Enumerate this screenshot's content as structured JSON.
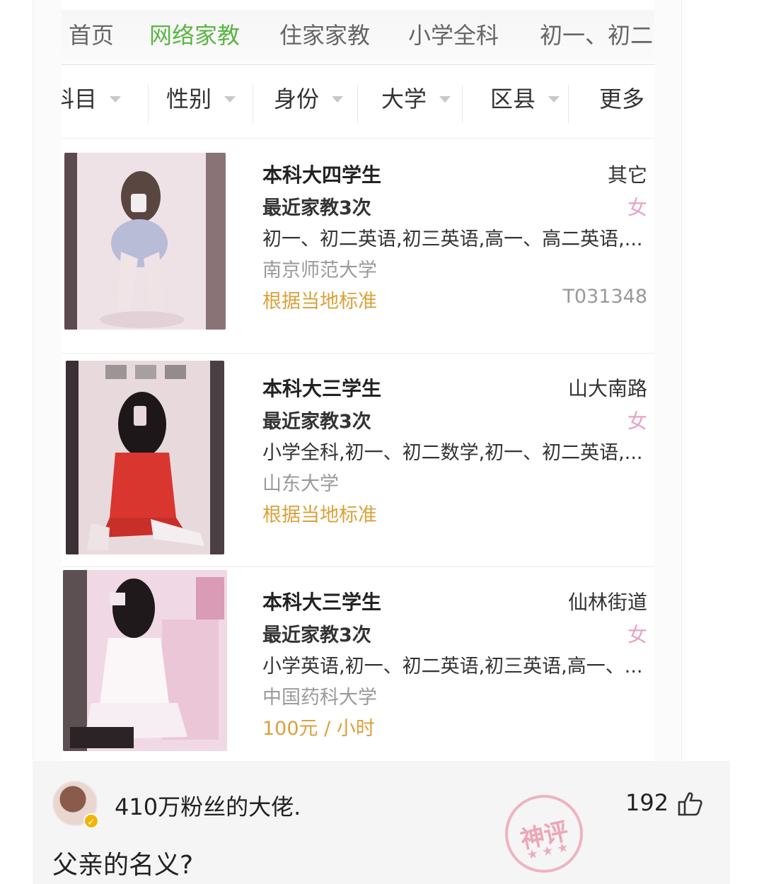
{
  "tabs": [
    "首页",
    "网络家教",
    "住家家教",
    "小学全科",
    "初一、初二"
  ],
  "active_tab": "网络家教",
  "filters": [
    "科目",
    "性别",
    "身份",
    "大学",
    "区县",
    "更多"
  ],
  "listings": [
    {
      "degree": "本科大四学生",
      "count": "最近家教3次",
      "subjects": "初一、初二英语,初三英语,高一、高二英语,...",
      "university": "南京师范大学",
      "price": "根据当地标准",
      "location": "其它",
      "gender": "女",
      "id": "T031348"
    },
    {
      "degree": "本科大三学生",
      "count": "最近家教3次",
      "subjects": "小学全科,初一、初二数学,初一、初二英语,...",
      "university": "山东大学",
      "price": "根据当地标准",
      "location": "山大南路",
      "gender": "女",
      "id": ""
    },
    {
      "degree": "本科大三学生",
      "count": "最近家教3次",
      "subjects": "小学英语,初一、初二英语,初三英语,高一、...",
      "university": "中国药科大学",
      "price": "100元 / 小时",
      "location": "仙林街道",
      "gender": "女",
      "id": ""
    }
  ],
  "comment": {
    "username": "410万粉丝的大佬.",
    "likes": "192",
    "text": "父亲的名义?",
    "stamp": "神评"
  },
  "colors": {
    "accent": "#5bb544",
    "price": "#d9a23a",
    "gender": "#e6a3c7"
  }
}
